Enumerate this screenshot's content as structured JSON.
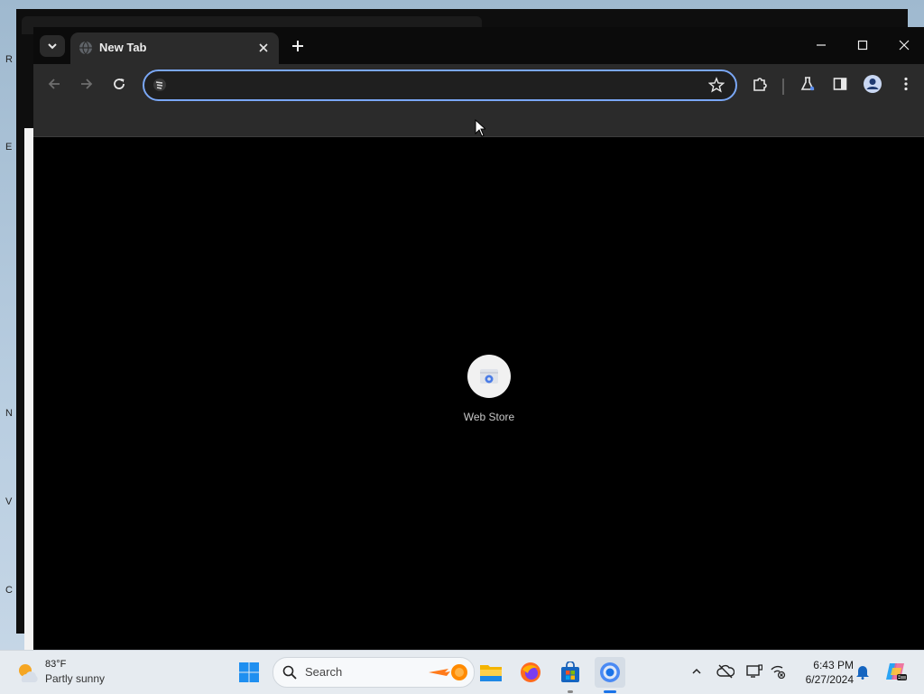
{
  "browser": {
    "tab": {
      "title": "New Tab"
    },
    "omnibox": {
      "value": ""
    },
    "shortcut": {
      "label": "Web Store"
    }
  },
  "taskbar": {
    "weather": {
      "temp": "83°F",
      "desc": "Partly sunny"
    },
    "search": {
      "placeholder": "Search"
    },
    "clock": {
      "time": "6:43 PM",
      "date": "6/27/2024"
    }
  }
}
